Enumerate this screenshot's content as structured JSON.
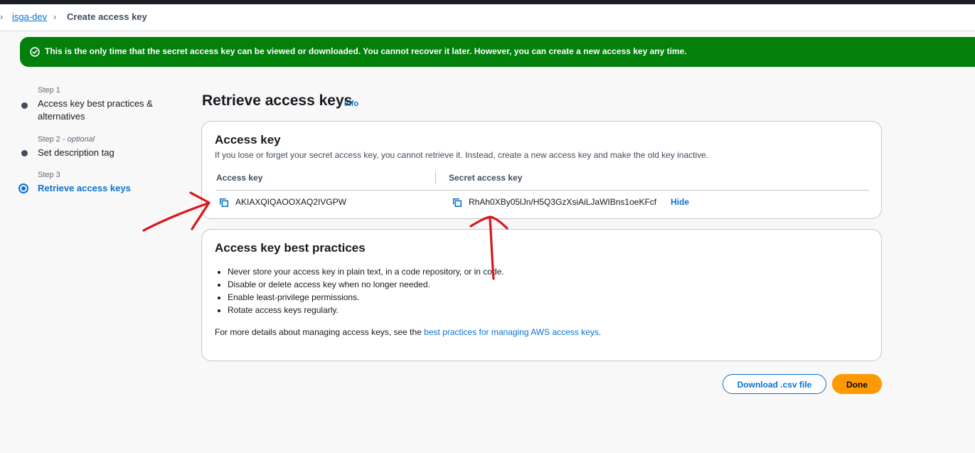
{
  "breadcrumb": {
    "parent": "isga-dev",
    "current": "Create access key"
  },
  "flash": {
    "message": "This is the only time that the secret access key can be viewed or downloaded. You cannot recover it later. However, you can create a new access key any time."
  },
  "steps": [
    {
      "label": "Step 1",
      "optional": "",
      "name": "Access key best practices & alternatives"
    },
    {
      "label": "Step 2",
      "optional": "optional",
      "name": "Set description tag"
    },
    {
      "label": "Step 3",
      "optional": "",
      "name": "Retrieve access keys"
    }
  ],
  "page": {
    "title": "Retrieve access keys",
    "info": "Info"
  },
  "access_key_card": {
    "title": "Access key",
    "description": "If you lose or forget your secret access key, you cannot retrieve it. Instead, create a new access key and make the old key inactive.",
    "col_access_key": "Access key",
    "col_secret": "Secret access key",
    "access_key_value": "AKIAXQIQAOOXAQ2IVGPW",
    "secret_value": "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",
    "hide_label": "Hide"
  },
  "best_practices": {
    "title": "Access key best practices",
    "items": [
      "Never store your access key in plain text, in a code repository, or in code.",
      "Disable or delete access key when no longer needed.",
      "Enable least-privilege permissions.",
      "Rotate access keys regularly."
    ],
    "more_prefix": "For more details about managing access keys, see the ",
    "more_link": "best practices for managing AWS access keys",
    "more_suffix": "."
  },
  "actions": {
    "download": "Download .csv file",
    "done": "Done"
  },
  "colors": {
    "success": "#037f0c",
    "link": "#0972d3",
    "primary": "#ff9900",
    "annotation": "#d9161c"
  }
}
